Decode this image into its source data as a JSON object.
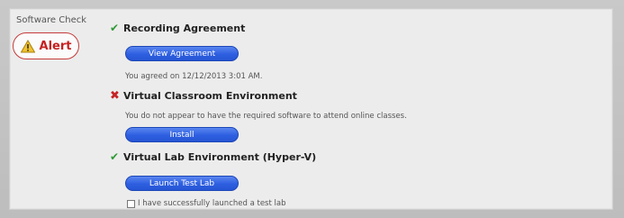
{
  "sidebar": {
    "label": "Software Check",
    "alert_label": "Alert"
  },
  "items": [
    {
      "status": "✔",
      "title": "Recording Agreement",
      "button": "View Agreement",
      "note": "You agreed on 12/12/2013 3:01 AM."
    },
    {
      "status": "✖",
      "title": "Virtual Classroom Environment",
      "note": "You do not appear to have the required software to attend online classes.",
      "button": "Install"
    },
    {
      "status": "✔",
      "title": "Virtual Lab Environment (Hyper-V)",
      "button": "Launch Test Lab",
      "checkbox_label": "I have successfully launched a test lab",
      "checkbox_checked": false
    }
  ],
  "colors": {
    "check": "#2f9a35",
    "cross": "#c52424",
    "alert": "#c62020",
    "button": "#2e5fe0"
  }
}
